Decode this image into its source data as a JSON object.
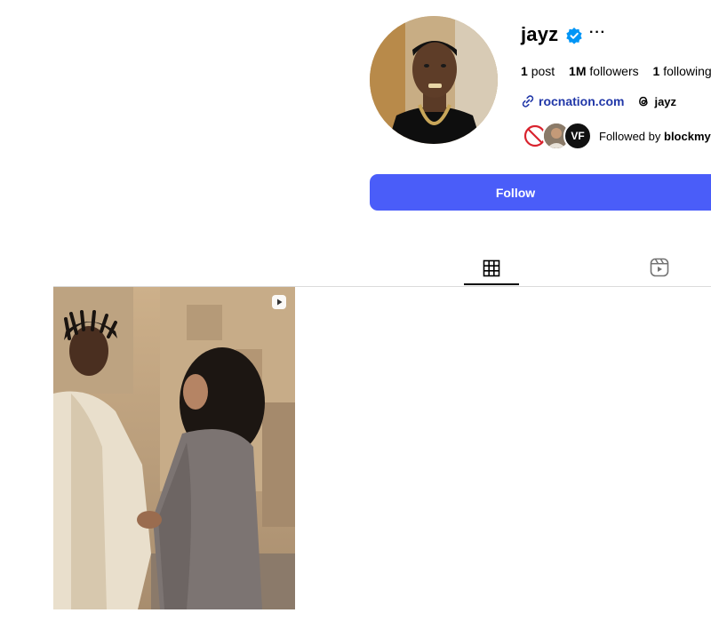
{
  "profile": {
    "username": "jayz",
    "verified": true,
    "more_label": "···",
    "stats": {
      "posts_count": "1",
      "posts_label": "post",
      "followers_count": "1M",
      "followers_label": "followers",
      "following_count": "1",
      "following_label": "following"
    },
    "website": "rocnation.com",
    "threads_handle": "jayz",
    "followed_by_prefix": "Followed by",
    "followed_by_names": "blockmy",
    "mutual_avatar_initials": "VF"
  },
  "actions": {
    "follow_label": "Follow"
  },
  "tabs": [
    {
      "name": "posts",
      "icon": "grid-icon",
      "active": true
    },
    {
      "name": "reels",
      "icon": "reels-icon",
      "active": false
    }
  ],
  "posts": [
    {
      "type": "reel",
      "badge_icon": "reel-icon"
    }
  ],
  "colors": {
    "accent": "#4a5df9",
    "link": "#2137a8",
    "verified": "#0095f6",
    "divider": "#dbdbdb"
  }
}
